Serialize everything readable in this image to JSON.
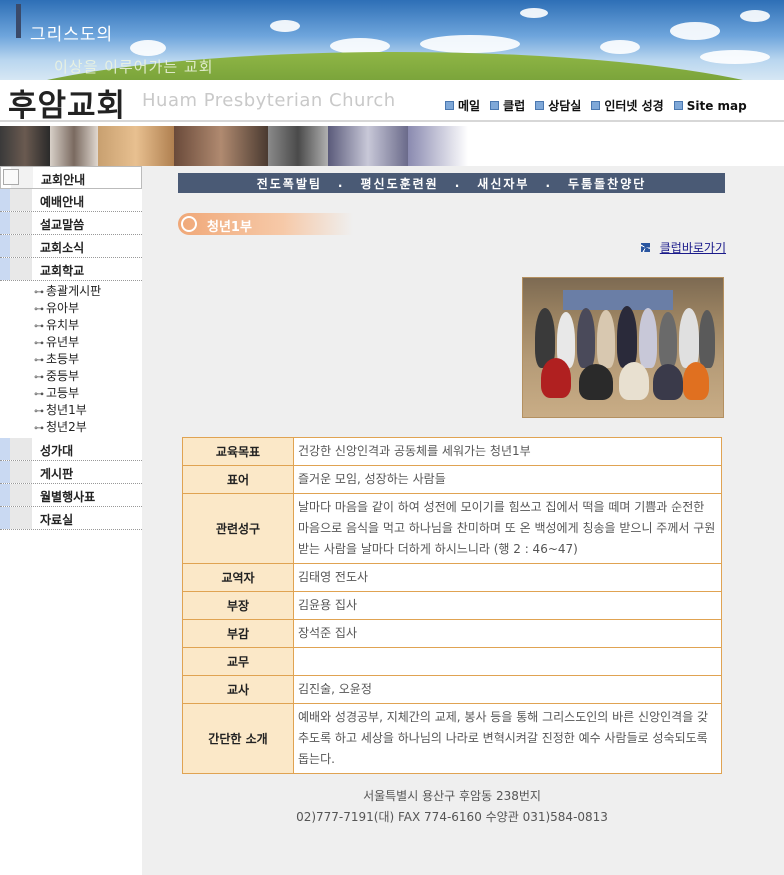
{
  "banner": {
    "line1": "그리스도의",
    "line2": "이상을 이루어가는 교회"
  },
  "header": {
    "logo_ko": "후암교회",
    "logo_en": "Huam Presbyterian Church",
    "nav": [
      {
        "label": "메일"
      },
      {
        "label": "클럽"
      },
      {
        "label": "상담실"
      },
      {
        "label": "인터넷 성경"
      },
      {
        "label": "Site map"
      }
    ]
  },
  "sidebar": {
    "menu_top": [
      {
        "label": "교회안내"
      },
      {
        "label": "예배안내"
      },
      {
        "label": "설교말씀"
      },
      {
        "label": "교회소식"
      },
      {
        "label": "교회학교"
      }
    ],
    "sub": [
      {
        "label": "총괄게시판"
      },
      {
        "label": "유아부"
      },
      {
        "label": "유치부"
      },
      {
        "label": "유년부"
      },
      {
        "label": "초등부"
      },
      {
        "label": "중등부"
      },
      {
        "label": "고등부"
      },
      {
        "label": "청년1부"
      },
      {
        "label": "청년2부"
      }
    ],
    "menu_bottom": [
      {
        "label": "성가대"
      },
      {
        "label": "게시판"
      },
      {
        "label": "월별행사표"
      },
      {
        "label": "자료실"
      }
    ]
  },
  "content": {
    "dept_bar": [
      "전도폭발팀",
      "평신도훈련원",
      "새신자부",
      "두툼돌찬양단"
    ],
    "dept_sep": ".",
    "title": "청년1부",
    "club_link": "클럽바로가기",
    "info": [
      {
        "key": "교육목표",
        "value": "건강한 신앙인격과 공동체를 세워가는 청년1부"
      },
      {
        "key": "표어",
        "value": "즐거운 모임, 성장하는 사람들"
      },
      {
        "key": "관련성구",
        "value": "날마다 마음을 같이 하여 성전에 모이기를 힘쓰고 집에서 떡을 떼며 기쁨과 순전한 마음으로 음식을 먹고 하나님을 찬미하며 또 온 백성에게 칭송을 받으니 주께서 구원 받는 사람을 날마다 더하게 하시느니라 (행 2 : 46~47)"
      },
      {
        "key": "교역자",
        "value": "김태영 전도사"
      },
      {
        "key": "부장",
        "value": "김윤용 집사"
      },
      {
        "key": "부감",
        "value": "장석준 집사"
      },
      {
        "key": "교무",
        "value": ""
      },
      {
        "key": "교사",
        "value": "김진술, 오윤정"
      },
      {
        "key": "간단한 소개",
        "value": "예배와 성경공부, 지체간의 교제, 봉사 등을 통해 그리스도인의 바른 신앙인격을 갖추도록 하고 세상을 하나님의 나라로 변혁시켜갈 진정한 예수 사람들로 성숙되도록 돕는다."
      }
    ]
  },
  "footer": {
    "address": "서울특별시 용산구 후암동 238번지",
    "phone": "02)777-7191(대) FAX 774-6160 수양관 031)584-0813"
  }
}
